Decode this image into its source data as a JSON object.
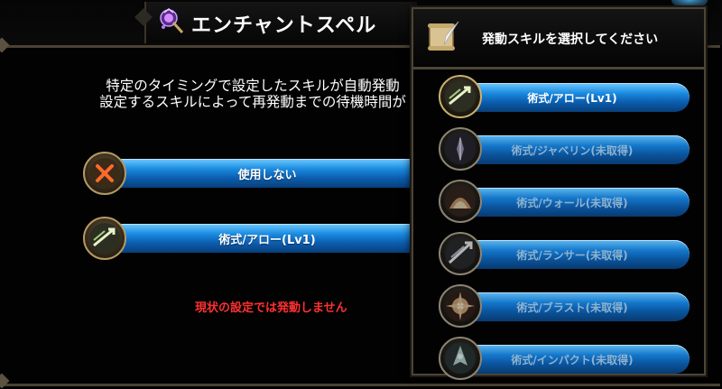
{
  "main": {
    "title": "エンチャントスペル",
    "title_icon": "magic-staff-icon",
    "description_lines": [
      "特定のタイミングで設定したスキルが自動発動",
      "設定するスキルによって再発動までの待機時間が"
    ],
    "options": [
      {
        "label": "使用しない",
        "icon": "cross-icon"
      },
      {
        "label": "術式/アロー(Lv1)",
        "icon": "arrow-skill-icon"
      }
    ],
    "status_text": "現状の設定では発動しません"
  },
  "picker": {
    "title": "発動スキルを選択してください",
    "header_icon": "scroll-quill-icon",
    "skills": [
      {
        "label": "術式/アロー(Lv1)",
        "acquired": true,
        "icon": "arrow-skill-icon"
      },
      {
        "label": "術式/ジャベリン(未取得)",
        "acquired": false,
        "icon": "javelin-skill-icon"
      },
      {
        "label": "術式/ウォール(未取得)",
        "acquired": false,
        "icon": "wall-skill-icon"
      },
      {
        "label": "術式/ランサー(未取得)",
        "acquired": false,
        "icon": "lancer-skill-icon"
      },
      {
        "label": "術式/ブラスト(未取得)",
        "acquired": false,
        "icon": "blast-skill-icon"
      },
      {
        "label": "術式/インパクト(未取得)",
        "acquired": false,
        "icon": "impact-skill-icon"
      }
    ]
  },
  "colors": {
    "button_blue": "#1a8be0",
    "warning_red": "#ff3030",
    "frame_gold": "#b49a63"
  }
}
